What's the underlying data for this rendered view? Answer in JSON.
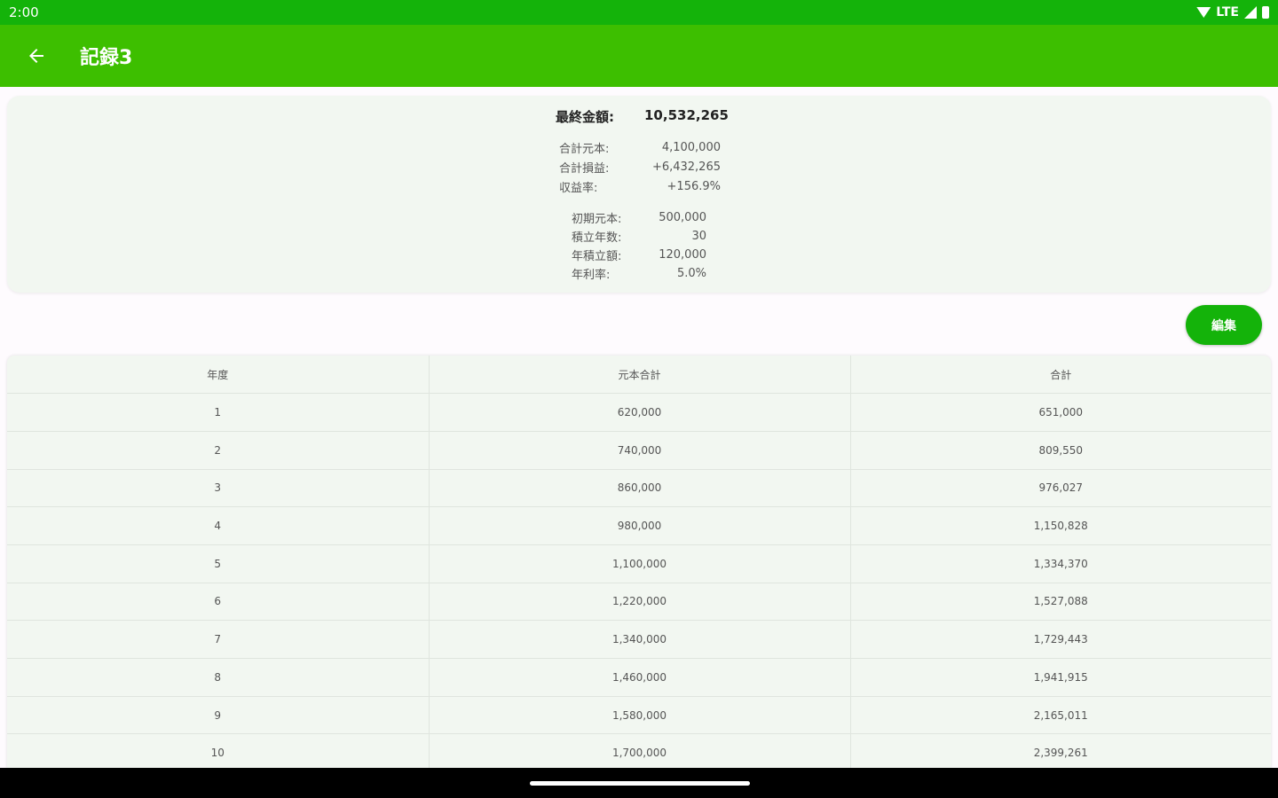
{
  "status_bar": {
    "time": "2:00",
    "network": "LTE"
  },
  "app_bar": {
    "title": "記録3"
  },
  "summary": {
    "final_label": "最終金額:",
    "final_value": "10,532,265",
    "stats": [
      {
        "label": "合計元本:",
        "value": "4,100,000"
      },
      {
        "label": "合計損益:",
        "value": "+6,432,265"
      },
      {
        "label": "収益率:",
        "value": "+156.9%"
      }
    ],
    "params": [
      {
        "label": "初期元本:",
        "value": "500,000"
      },
      {
        "label": "積立年数:",
        "value": "30"
      },
      {
        "label": "年積立額:",
        "value": "120,000"
      },
      {
        "label": "年利率:",
        "value": "5.0%"
      }
    ]
  },
  "edit_button": {
    "label": "編集"
  },
  "table": {
    "headers": [
      "年度",
      "元本合計",
      "合計"
    ],
    "rows": [
      [
        "1",
        "620,000",
        "651,000"
      ],
      [
        "2",
        "740,000",
        "809,550"
      ],
      [
        "3",
        "860,000",
        "976,027"
      ],
      [
        "4",
        "980,000",
        "1,150,828"
      ],
      [
        "5",
        "1,100,000",
        "1,334,370"
      ],
      [
        "6",
        "1,220,000",
        "1,527,088"
      ],
      [
        "7",
        "1,340,000",
        "1,729,443"
      ],
      [
        "8",
        "1,460,000",
        "1,941,915"
      ],
      [
        "9",
        "1,580,000",
        "2,165,011"
      ],
      [
        "10",
        "1,700,000",
        "2,399,261"
      ]
    ]
  }
}
